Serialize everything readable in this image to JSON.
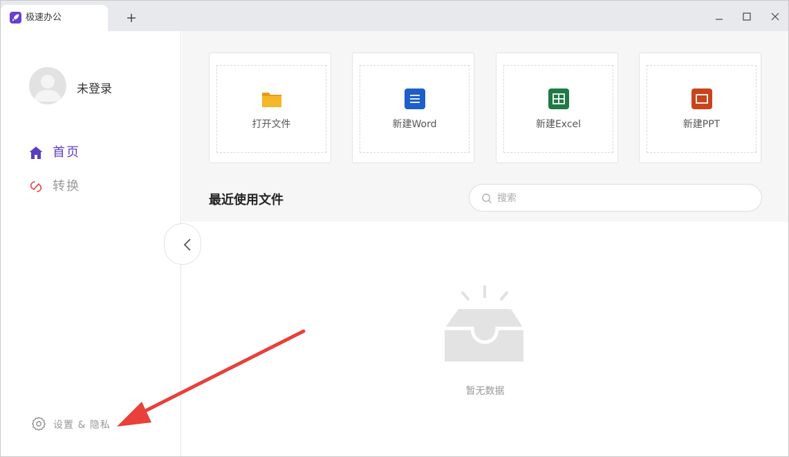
{
  "app": {
    "tab_title": "极速办公",
    "new_tab_icon": "plus-icon",
    "window_controls": [
      "minimize-icon",
      "maximize-icon",
      "close-icon"
    ]
  },
  "sidebar": {
    "user_name": "未登录",
    "nav": [
      {
        "label": "首页",
        "icon": "home-icon",
        "active": true,
        "color": "#5a3fc0"
      },
      {
        "label": "转换",
        "icon": "convert-icon",
        "active": false,
        "color": "#999999"
      }
    ],
    "settings_label": "设置 & 隐私"
  },
  "main": {
    "cards": [
      {
        "label": "打开文件",
        "icon": "folder-icon",
        "color": "#f5a623"
      },
      {
        "label": "新建Word",
        "icon": "word-icon",
        "color": "#1e5fc9"
      },
      {
        "label": "新建Excel",
        "icon": "excel-icon",
        "color": "#1f7a45"
      },
      {
        "label": "新建PPT",
        "icon": "ppt-icon",
        "color": "#c8441c"
      }
    ],
    "recent_title": "最近使用文件",
    "search_placeholder": "搜索",
    "empty_text": "暂无数据"
  },
  "colors": {
    "accent": "#5a3fc0",
    "annotation_arrow": "#e8403a"
  }
}
